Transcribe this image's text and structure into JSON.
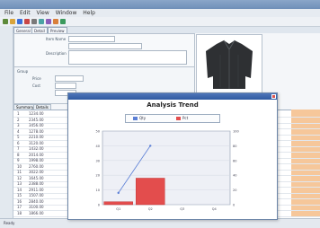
{
  "app": {
    "title": "",
    "menu": [
      "File",
      "Edit",
      "View",
      "Window",
      "Help"
    ]
  },
  "doc_tabs": [
    "General",
    "Detail",
    "Preview"
  ],
  "form": {
    "item_no_label": "Item Name",
    "item_no_value": "",
    "desc_label": "Description",
    "group_label": "Group",
    "field_a_label": "Price",
    "field_a_value": "",
    "field_b_label": "Cost",
    "field_b_value": ""
  },
  "grid": {
    "tabs": [
      "Summary",
      "Details"
    ],
    "rows": [
      {
        "id": "1",
        "val": "1234.00"
      },
      {
        "id": "2",
        "val": "2345.00"
      },
      {
        "id": "3",
        "val": "3456.00"
      },
      {
        "id": "4",
        "val": "1278.00"
      },
      {
        "id": "5",
        "val": "2210.00"
      },
      {
        "id": "6",
        "val": "3120.00"
      },
      {
        "id": "7",
        "val": "1432.00"
      },
      {
        "id": "8",
        "val": "2014.00"
      },
      {
        "id": "9",
        "val": "1998.00"
      },
      {
        "id": "10",
        "val": "2760.00"
      },
      {
        "id": "11",
        "val": "3022.00"
      },
      {
        "id": "12",
        "val": "1645.00"
      },
      {
        "id": "13",
        "val": "2388.00"
      },
      {
        "id": "14",
        "val": "2911.00"
      },
      {
        "id": "15",
        "val": "1507.00"
      },
      {
        "id": "16",
        "val": "2840.00"
      },
      {
        "id": "17",
        "val": "3100.00"
      },
      {
        "id": "18",
        "val": "1866.00"
      }
    ]
  },
  "status": [
    "Ready",
    "",
    "",
    "",
    "",
    ""
  ],
  "dialog": {
    "window_title": "Analysis Trend",
    "legend": [
      "Qty",
      "Pct"
    ]
  },
  "chart_data": {
    "type": "bar",
    "title": "Analysis Trend",
    "categories": [
      "Q1",
      "Q2",
      "Q3",
      "Q4"
    ],
    "series": [
      {
        "name": "Pct",
        "values": [
          2,
          18,
          0,
          0
        ],
        "kind": "bar",
        "color": "#e34d4d"
      },
      {
        "name": "Qty",
        "values": [
          8,
          40,
          0,
          0
        ],
        "kind": "line",
        "color": "#5b7fd6"
      }
    ],
    "ylim": [
      0,
      50
    ],
    "y2lim": [
      0,
      100
    ],
    "xlabel": "",
    "ylabel": "",
    "grid": true,
    "legend_position": "top"
  },
  "colors": {
    "accent": "#2f5aa0",
    "bar": "#e34d4d",
    "line": "#5b7fd6",
    "highlight_column": "#f6c79a"
  }
}
